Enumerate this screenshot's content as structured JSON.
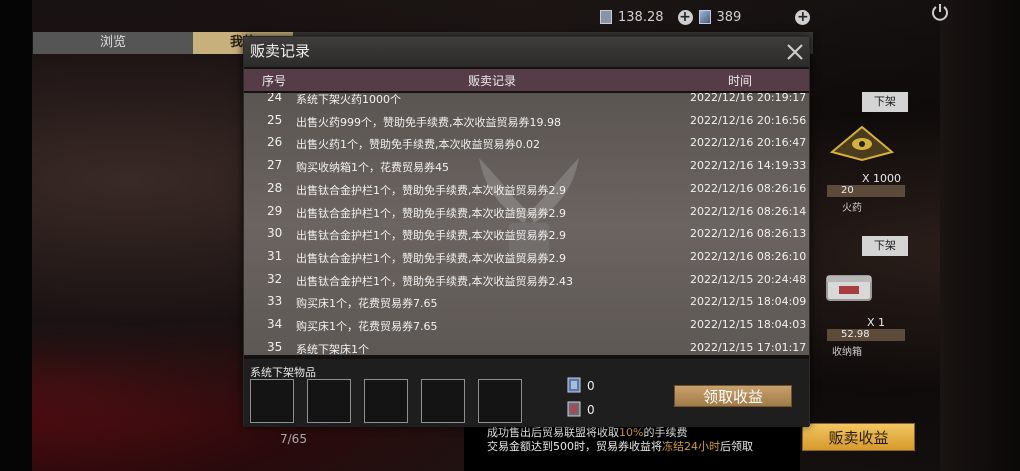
{
  "topbar": {
    "currency1_value": "138.28",
    "currency2_value": "389",
    "currency1_icon": "coupon-icon",
    "currency2_icon": "card-icon"
  },
  "tabs": [
    {
      "label": "浏览"
    },
    {
      "label": "我的"
    }
  ],
  "modal": {
    "title": "贩卖记录",
    "columns": {
      "no": "序号",
      "record": "贩卖记录",
      "time": "时间"
    },
    "rows": [
      {
        "no": "24",
        "record": "系统下架火药1000个",
        "time": "2022/12/16 20:19:17"
      },
      {
        "no": "25",
        "record": "出售火药999个，赞助免手续费,本次收益贸易券19.98",
        "time": "2022/12/16 20:16:56"
      },
      {
        "no": "26",
        "record": "出售火药1个，赞助免手续费,本次收益贸易券0.02",
        "time": "2022/12/16 20:16:47"
      },
      {
        "no": "27",
        "record": "购买收纳箱1个，花费贸易券45",
        "time": "2022/12/16 14:19:33"
      },
      {
        "no": "28",
        "record": "出售钛合金护栏1个，赞助免手续费,本次收益贸易券2.9",
        "time": "2022/12/16 08:26:16"
      },
      {
        "no": "29",
        "record": "出售钛合金护栏1个，赞助免手续费,本次收益贸易券2.9",
        "time": "2022/12/16 08:26:14"
      },
      {
        "no": "30",
        "record": "出售钛合金护栏1个，赞助免手续费,本次收益贸易券2.9",
        "time": "2022/12/16 08:26:13"
      },
      {
        "no": "31",
        "record": "出售钛合金护栏1个，赞助免手续费,本次收益贸易券2.9",
        "time": "2022/12/16 08:26:10"
      },
      {
        "no": "32",
        "record": "出售钛合金护栏1个，赞助免手续费,本次收益贸易券2.43",
        "time": "2022/12/15 20:24:48"
      },
      {
        "no": "33",
        "record": "购买床1个，花费贸易券7.65",
        "time": "2022/12/15 18:04:09"
      },
      {
        "no": "34",
        "record": "购买床1个，花费贸易券7.65",
        "time": "2022/12/15 18:04:03"
      },
      {
        "no": "35",
        "record": "系统下架床1个",
        "time": "2022/12/15 17:01:17"
      }
    ],
    "delist_title": "系统下架物品",
    "currency1_amount": "0",
    "currency2_amount": "0",
    "collect_label": "领取收益"
  },
  "cards": [
    {
      "delist_label": "下架",
      "qty": "X 1000",
      "price": "20",
      "name": "火药"
    },
    {
      "delist_label": "下架",
      "qty": "X 1",
      "price": "52.98",
      "name": "收纳箱"
    }
  ],
  "notice": {
    "line1_a": "成功售出后贸易联盟将收取",
    "line1_hl": "10%",
    "line1_b": "的手续费",
    "line2_a": "交易金额达到500时，贸易券收益将",
    "line2_hl": "冻结24小时",
    "line2_b": "后领取"
  },
  "sell_income_label": "贩卖收益",
  "page_count": "7/65",
  "colors": {
    "accent_gold": "#d59a2c",
    "header_purple": "#563c46",
    "highlight_orange": "#d29a3a"
  }
}
